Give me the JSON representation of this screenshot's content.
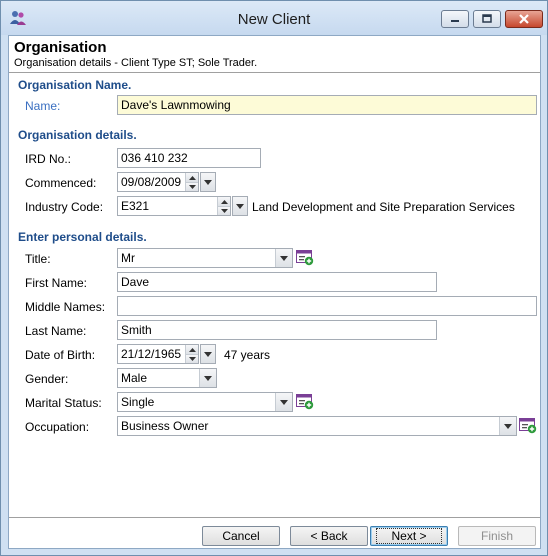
{
  "window": {
    "title": "New Client"
  },
  "header": {
    "title": "Organisation",
    "subtitle": "Organisation details - Client Type ST; Sole Trader."
  },
  "org_name_section": {
    "heading": "Organisation Name.",
    "name_label": "Name:",
    "name_value": "Dave's Lawnmowing"
  },
  "org_details_section": {
    "heading": "Organisation details.",
    "ird_label": "IRD No.:",
    "ird_value": "036 410 232",
    "commenced_label": "Commenced:",
    "commenced_value": "09/08/2009",
    "industry_label": "Industry Code:",
    "industry_code": "E321",
    "industry_desc": "Land Development and Site Preparation Services"
  },
  "personal_section": {
    "heading": "Enter personal details.",
    "title_label": "Title:",
    "title_value": "Mr",
    "first_label": "First Name:",
    "first_value": "Dave",
    "middle_label": "Middle Names:",
    "middle_value": "",
    "last_label": "Last Name:",
    "last_value": "Smith",
    "dob_label": "Date of Birth:",
    "dob_value": "21/12/1965",
    "age_text": "47 years",
    "gender_label": "Gender:",
    "gender_value": "Male",
    "marital_label": "Marital Status:",
    "marital_value": "Single",
    "occupation_label": "Occupation:",
    "occupation_value": "Business Owner"
  },
  "buttons": {
    "cancel": "Cancel",
    "back": "< Back",
    "next": "Next >",
    "finish": "Finish"
  },
  "colors": {
    "section_heading": "#1f4d8a",
    "active_label": "#3a6fc1",
    "highlight_field": "#fdfbd7"
  },
  "icons": {
    "app": "people-icon",
    "add_lookup": "add-list-item-icon"
  }
}
